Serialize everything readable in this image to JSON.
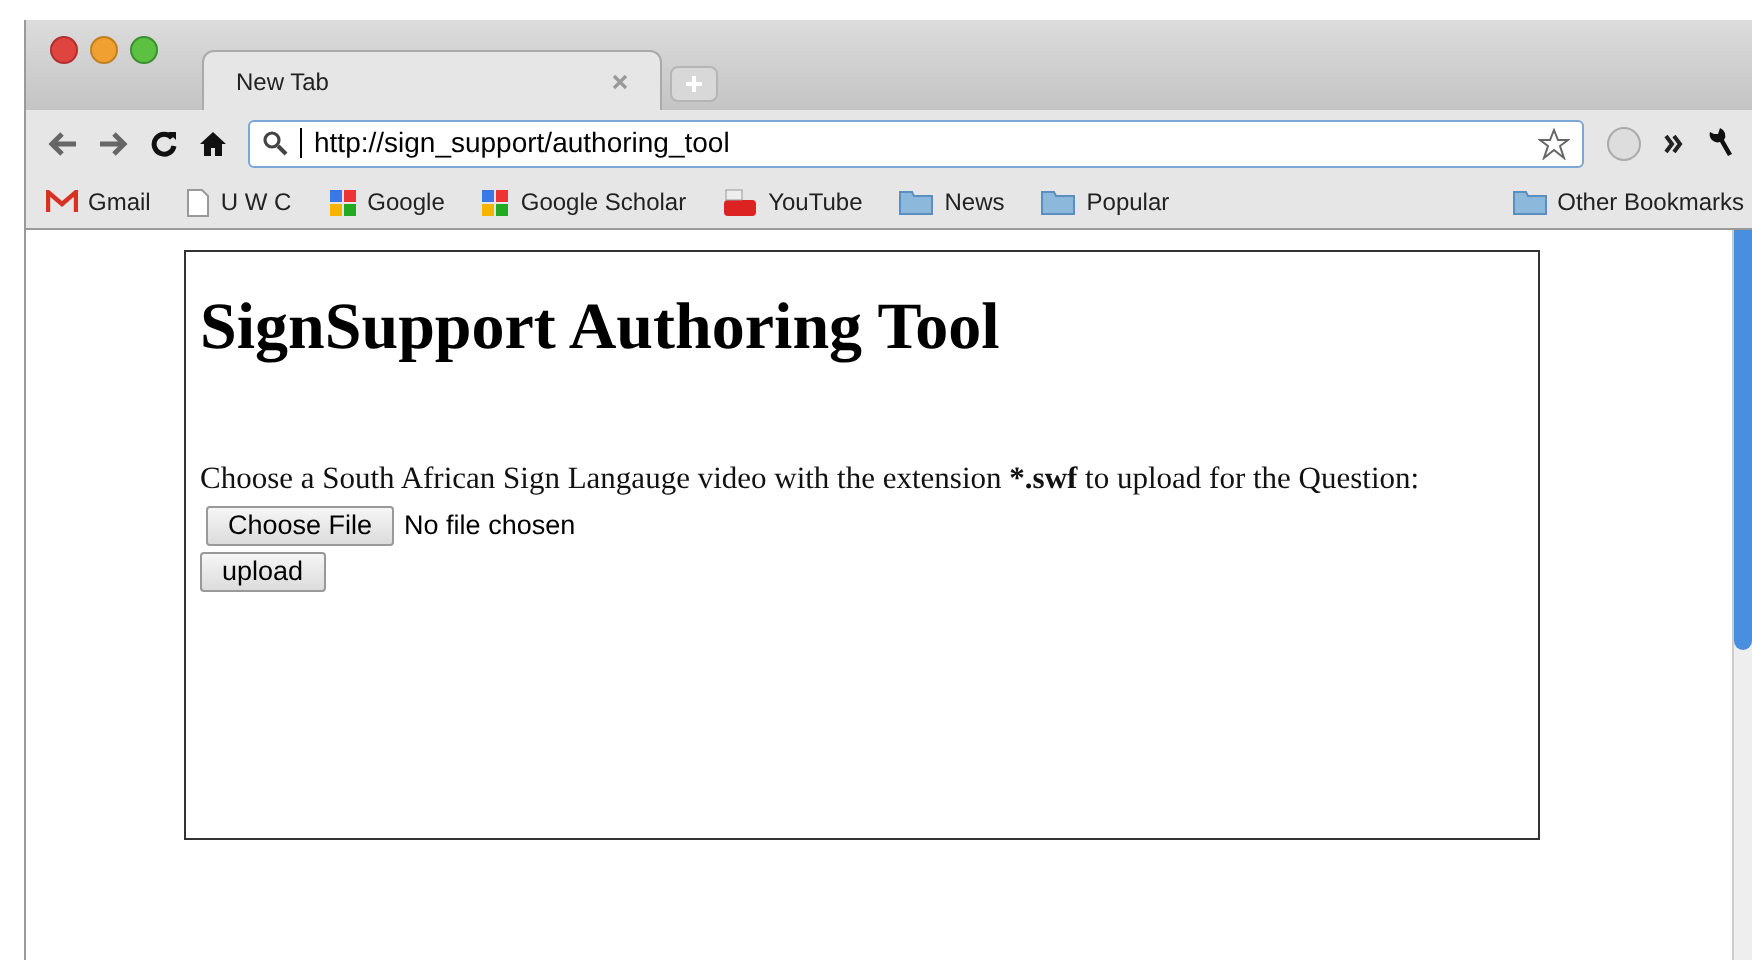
{
  "tabs": [
    {
      "label": "New Tab",
      "selected": true
    }
  ],
  "address_bar": {
    "value": "http://sign_support/authoring_tool"
  },
  "bookmarks": [
    {
      "label": "Gmail",
      "kind": "gmail"
    },
    {
      "label": "U W C",
      "kind": "page"
    },
    {
      "label": "Google",
      "kind": "google"
    },
    {
      "label": "Google Scholar",
      "kind": "google"
    },
    {
      "label": "YouTube",
      "kind": "youtube"
    },
    {
      "label": "News",
      "kind": "folder"
    },
    {
      "label": "Popular",
      "kind": "folder"
    }
  ],
  "other_bookmarks": {
    "label": "Other Bookmarks",
    "kind": "folder"
  },
  "page": {
    "heading": "SignSupport Authoring Tool",
    "instruction": {
      "before": "Choose a South African Sign Langauge video with the extension ",
      "bold": "*.swf",
      "after": " to upload for the Question:"
    },
    "file_button": "Choose File",
    "file_status": "No file chosen",
    "upload_button": "upload"
  }
}
